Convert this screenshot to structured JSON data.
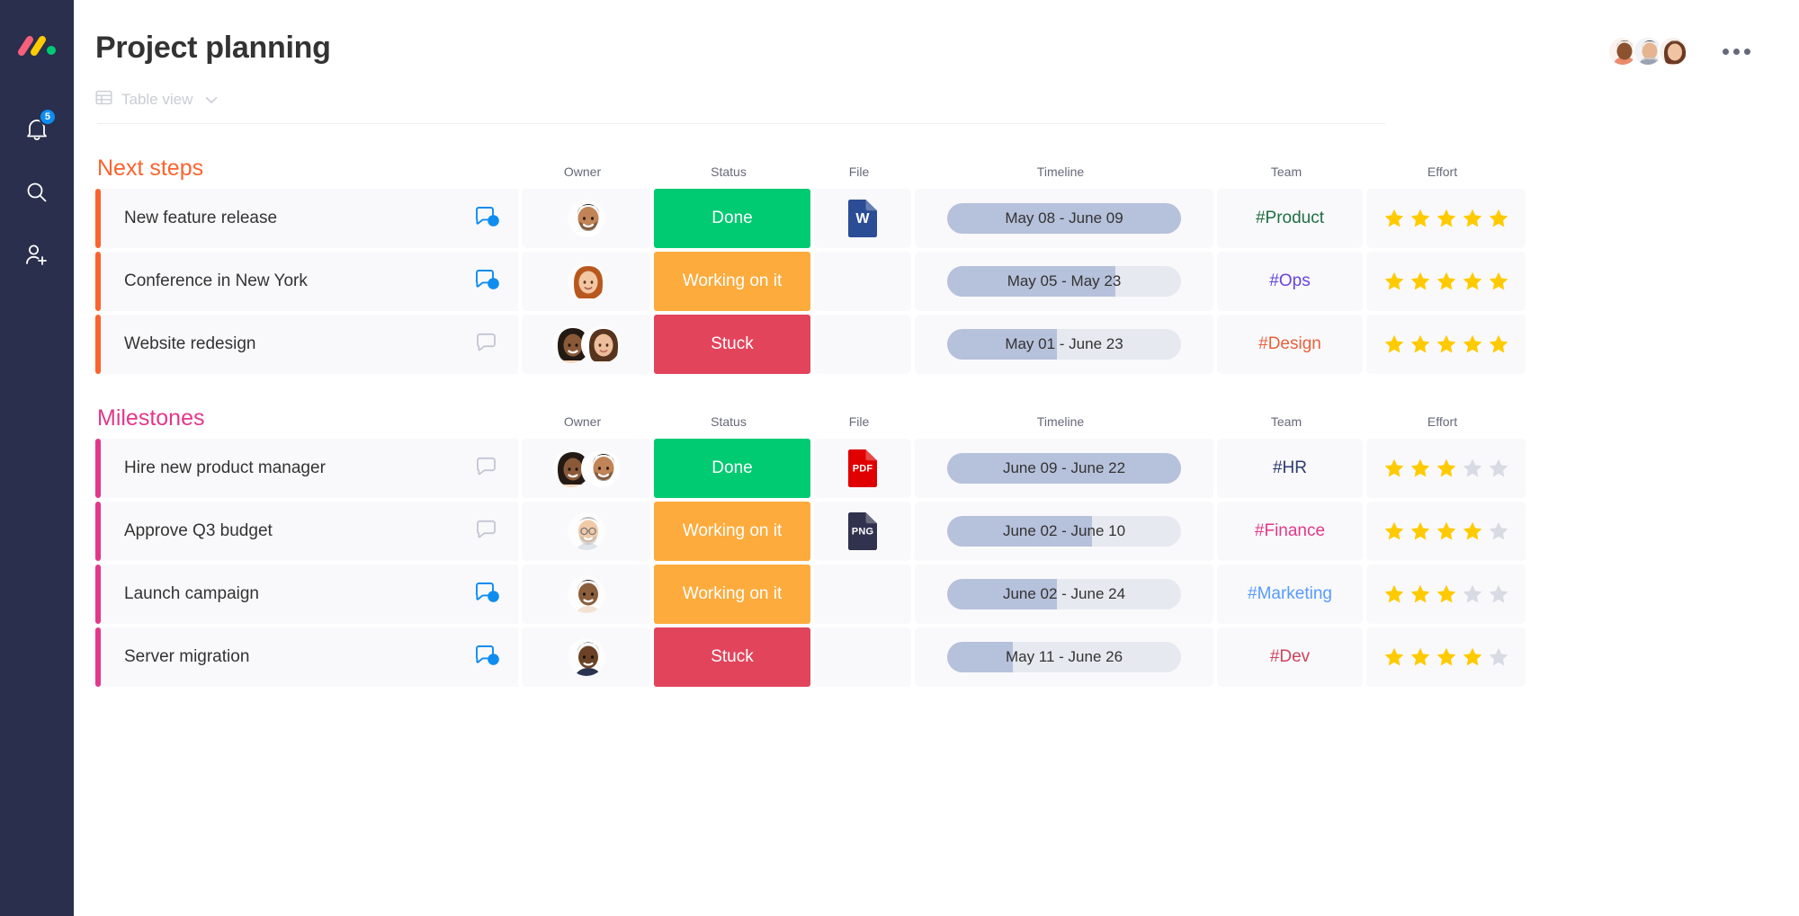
{
  "rail": {
    "logo": "monday-logo",
    "items": [
      {
        "icon": "bell-icon",
        "name": "notifications",
        "badge": "5"
      },
      {
        "icon": "search-icon",
        "name": "search",
        "badge": ""
      },
      {
        "icon": "invite-user-icon",
        "name": "invite-members",
        "badge": ""
      }
    ]
  },
  "header": {
    "title": "Project planning",
    "view_label": "Table view",
    "view_icon": "table-icon",
    "chevron": "chevron-down-icon",
    "more_menu": "more-options-icon",
    "member_count": 3
  },
  "columns": [
    "Owner",
    "Status",
    "File",
    "Timeline",
    "Team",
    "Effort"
  ],
  "colors": {
    "done": "#00ca72",
    "working": "#fdab3d",
    "stuck": "#e2445c",
    "group_next_steps": "#fb642e",
    "group_milestones": "#e2388a",
    "star_on": "#ffcb00",
    "star_off": "#d8dbe3",
    "timeline_track": "#e6e9ef",
    "timeline_fill": "#b6c1db"
  },
  "groups": [
    {
      "title": "Next steps",
      "accent": "orange",
      "rows": [
        {
          "task": "New feature release",
          "chat": "chat-active",
          "owners": [
            "avatar-male-1"
          ],
          "status": "Done",
          "status_color": "#00ca72",
          "file": "W",
          "file_type": "word",
          "timeline": "May 08 - June 09",
          "progress": 100,
          "team": "#Product",
          "team_color": "#1f6e43",
          "effort": 5
        },
        {
          "task": "Conference in New York",
          "chat": "chat-active",
          "owners": [
            "avatar-female-1"
          ],
          "status": "Working on it",
          "status_color": "#fdab3d",
          "file": "",
          "file_type": "none",
          "timeline": "May 05 - May 23",
          "progress": 72,
          "team": "#Ops",
          "team_color": "#6645d9",
          "effort": 5
        },
        {
          "task": "Website redesign",
          "chat": "chat-empty",
          "owners": [
            "avatar-female-2",
            "avatar-female-3"
          ],
          "status": "Stuck",
          "status_color": "#e2445c",
          "file": "",
          "file_type": "none",
          "timeline": "May 01 - June 23",
          "progress": 47,
          "team": "#Design",
          "team_color": "#e8613c",
          "effort": 5
        }
      ]
    },
    {
      "title": "Milestones",
      "accent": "pink",
      "rows": [
        {
          "task": "Hire new product manager",
          "chat": "chat-empty",
          "owners": [
            "avatar-female-2",
            "avatar-male-1"
          ],
          "status": "Done",
          "status_color": "#00ca72",
          "file": "PDF",
          "file_type": "pdf",
          "timeline": "June 09 - June 22",
          "progress": 100,
          "team": "#HR",
          "team_color": "#2b3b6e",
          "effort": 3
        },
        {
          "task": "Approve Q3 budget",
          "chat": "chat-empty",
          "owners": [
            "avatar-male-2"
          ],
          "status": "Working on it",
          "status_color": "#fdab3d",
          "file": "PNG",
          "file_type": "png",
          "timeline": "June 02 - June 10",
          "progress": 62,
          "team": "#Finance",
          "team_color": "#e2388a",
          "effort": 4
        },
        {
          "task": "Launch campaign",
          "chat": "chat-active",
          "owners": [
            "avatar-male-3"
          ],
          "status": "Working on it",
          "status_color": "#fdab3d",
          "file": "",
          "file_type": "none",
          "timeline": "June 02  - June 24",
          "progress": 47,
          "team": "#Marketing",
          "team_color": "#579bfc",
          "effort": 3
        },
        {
          "task": "Server migration",
          "chat": "chat-active",
          "owners": [
            "avatar-male-4"
          ],
          "status": "Stuck",
          "status_color": "#e2445c",
          "file": "",
          "file_type": "none",
          "timeline": "May 11 - June 26",
          "progress": 28,
          "team": "#Dev",
          "team_color": "#d0435c",
          "effort": 4
        }
      ]
    }
  ]
}
